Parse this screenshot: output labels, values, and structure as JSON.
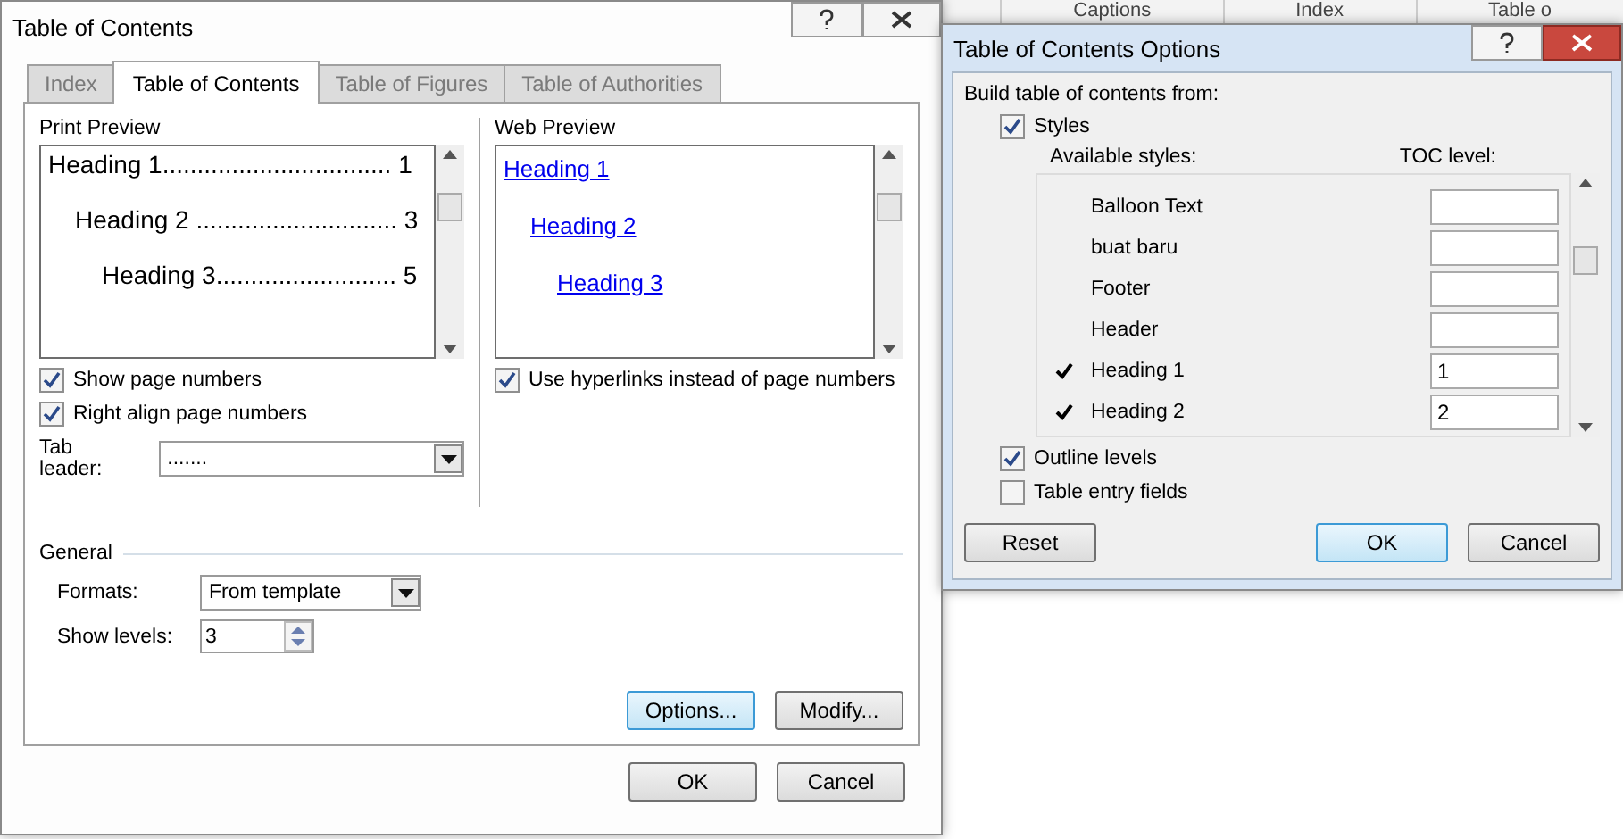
{
  "background": {
    "ribbon_labels": [
      "Captions",
      "Index",
      "Table o"
    ]
  },
  "main_dialog": {
    "title": "Table of Contents",
    "tabs": [
      {
        "label": "Index",
        "selected": false
      },
      {
        "label": "Table of Contents",
        "selected": true
      },
      {
        "label": "Table of Figures",
        "selected": false
      },
      {
        "label": "Table of Authorities",
        "selected": false
      }
    ],
    "print_preview": {
      "label": "Print Preview",
      "entries": [
        {
          "text": "Heading 1................................. 1",
          "children": [
            {
              "text": "Heading 2 ............................. 3",
              "children": [
                {
                  "text": "Heading 3.......................... 5"
                }
              ]
            }
          ]
        }
      ]
    },
    "print_options": [
      {
        "label": "Show page numbers",
        "checked": true
      },
      {
        "label": "Right align page numbers",
        "checked": true
      }
    ],
    "tab_leader": {
      "label": "Tab leader:",
      "value": "......."
    },
    "web_preview": {
      "label": "Web Preview",
      "links": [
        {
          "text": "Heading 1",
          "children": [
            {
              "text": "Heading 2",
              "children": [
                {
                  "text": "Heading 3"
                }
              ]
            }
          ]
        }
      ]
    },
    "web_options": [
      {
        "label": "Use hyperlinks instead of page numbers",
        "checked": true
      }
    ],
    "general": {
      "title": "General",
      "formats": {
        "label": "Formats:",
        "value": "From template"
      },
      "show_levels": {
        "label": "Show levels:",
        "value": "3"
      }
    },
    "panel_buttons": [
      "Options...",
      "Modify..."
    ],
    "buttons": [
      "OK",
      "Cancel"
    ]
  },
  "options_dialog": {
    "title": "Table of Contents Options",
    "build_label": "Build table of contents from:",
    "styles": {
      "label": "Styles",
      "checked": true
    },
    "columns": [
      "Available styles:",
      "TOC level:"
    ],
    "style_rows": [
      {
        "name": "Balloon Text",
        "checked": false
      },
      {
        "name": "buat baru",
        "checked": false
      },
      {
        "name": "Footer",
        "checked": false
      },
      {
        "name": "Header",
        "checked": false
      },
      {
        "name": "Heading 1",
        "checked": true,
        "toc_level": "1"
      },
      {
        "name": "Heading 2",
        "checked": true,
        "toc_level": "2"
      }
    ],
    "sources": [
      {
        "label": "Outline levels",
        "checked": true
      },
      {
        "label": "Table entry fields",
        "checked": false
      }
    ],
    "buttons": [
      {
        "label": "Reset",
        "kind": "plain"
      },
      {
        "label": "OK",
        "kind": "default"
      },
      {
        "label": "Cancel",
        "kind": "plain"
      }
    ]
  }
}
